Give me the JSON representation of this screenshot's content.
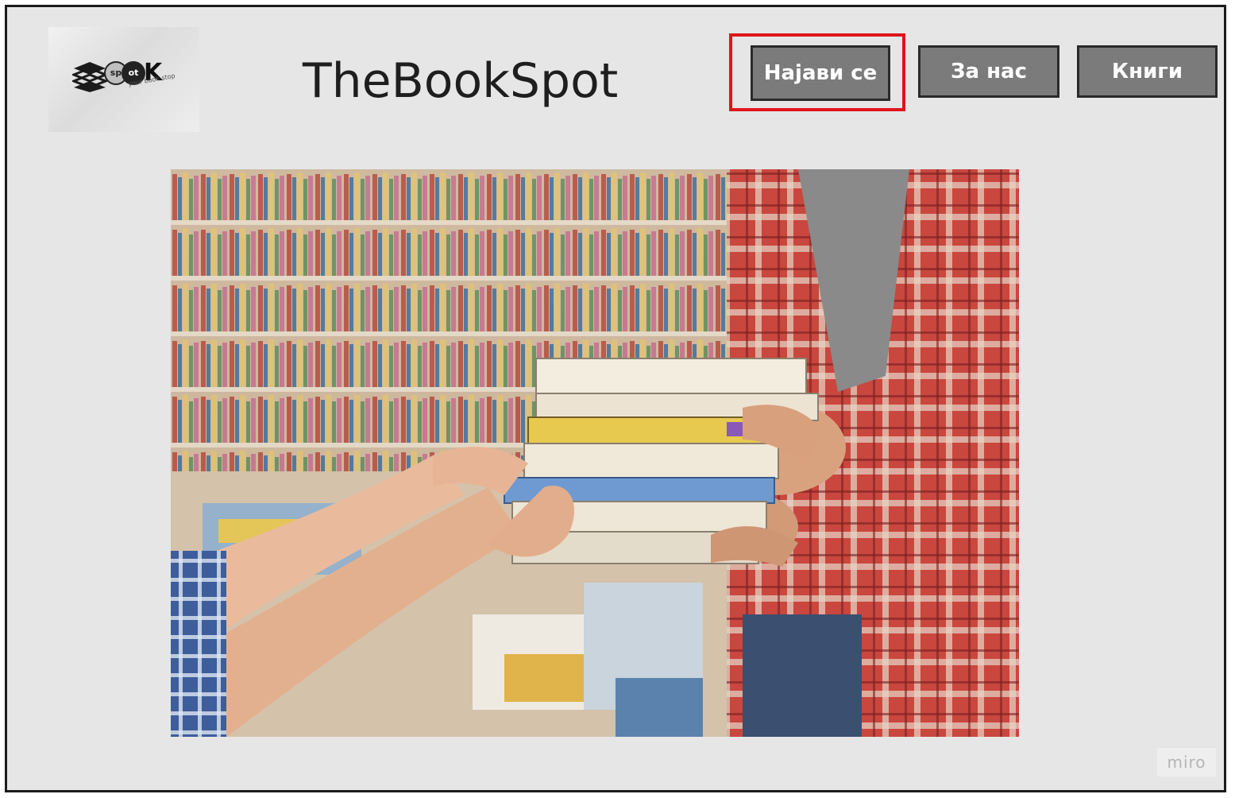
{
  "header": {
    "logo": {
      "sp": "sp",
      "ot": "ot",
      "k": "K",
      "tagline": "your book stop"
    },
    "title": "TheBookSpot",
    "nav": [
      {
        "label": "Најави се",
        "highlighted": true
      },
      {
        "label": "За нас"
      },
      {
        "label": "Книги"
      }
    ]
  },
  "hero": {
    "icon": "bookstore-photo"
  },
  "watermark": "miro",
  "colors": {
    "background": "#e6e6e6",
    "button": "#7b7b7b",
    "highlight": "#e0141b"
  }
}
